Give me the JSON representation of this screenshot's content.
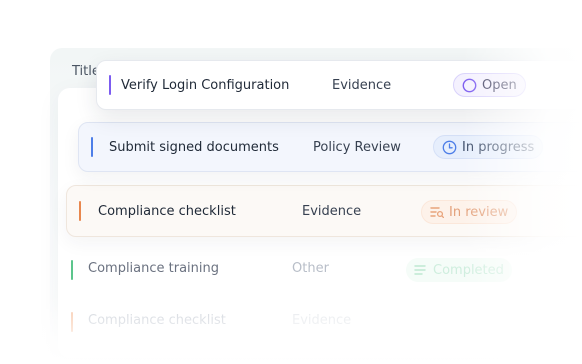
{
  "table": {
    "column_header": "Title"
  },
  "rows": [
    {
      "title": "Verify Login Configuration",
      "category": "Evidence",
      "status": "Open",
      "status_icon": "circle-icon",
      "accent": "#7c5cf0"
    },
    {
      "title": "Submit signed documents",
      "category": "Policy Review",
      "status": "In progress",
      "status_icon": "clock-icon",
      "accent": "#4d7ee8"
    },
    {
      "title": "Compliance checklist",
      "category": "Evidence",
      "status": "In review",
      "status_icon": "review-icon",
      "accent": "#e8874e"
    },
    {
      "title": "Compliance training",
      "category": "Other",
      "status": "Completed",
      "status_icon": "completed-icon",
      "accent": "#5cc58c"
    },
    {
      "title": "Compliance checklist",
      "category": "Evidence",
      "status": "",
      "status_icon": "",
      "accent": "#f7c4a4"
    }
  ]
}
